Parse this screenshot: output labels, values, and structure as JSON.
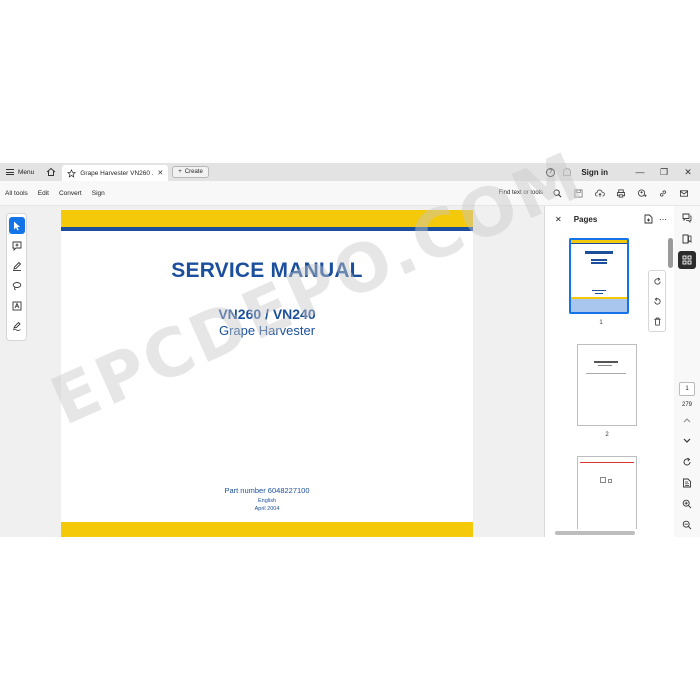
{
  "titlebar": {
    "menu_label": "Menu",
    "tab_title": "Grape Harvester VN260 ...",
    "create_label": "Create",
    "signin_label": "Sign in"
  },
  "toolbar": {
    "items": [
      "All tools",
      "Edit",
      "Convert",
      "Sign"
    ],
    "find_label": "Find text or tools"
  },
  "document": {
    "title": "SERVICE MANUAL",
    "model": "VN260 / VN240",
    "subtitle": "Grape Harvester",
    "part_number": "Part number 6048227100",
    "language": "English",
    "date": "April 2004",
    "colors": {
      "brand_blue": "#1b4f9c",
      "band_yellow": "#f4c90a"
    }
  },
  "pages_panel": {
    "title": "Pages",
    "thumbnails": [
      {
        "label": "1",
        "selected": true
      },
      {
        "label": "2",
        "selected": false
      },
      {
        "label": "",
        "selected": false
      }
    ]
  },
  "page_nav": {
    "current": "1",
    "total": "279"
  },
  "watermark": "EPCDEPO.COM",
  "accent_color": "#1473e6"
}
